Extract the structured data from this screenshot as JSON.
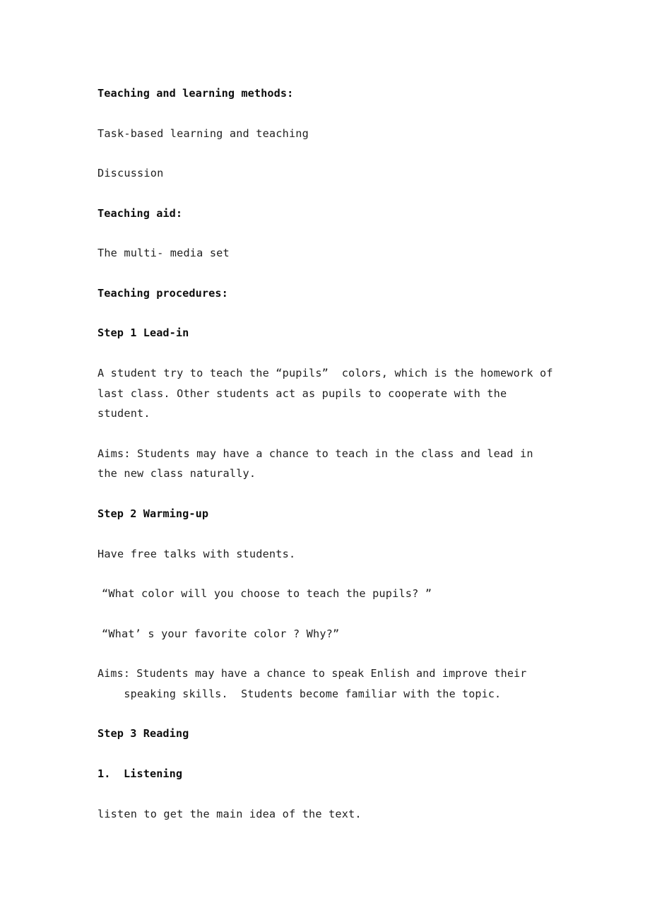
{
  "document": {
    "blocks": [
      {
        "id": "methods-heading",
        "kind": "heading",
        "text": "Teaching and learning methods:"
      },
      {
        "id": "methods-item-1",
        "kind": "body",
        "text": "Task-based learning and teaching"
      },
      {
        "id": "methods-item-2",
        "kind": "body",
        "text": "Discussion"
      },
      {
        "id": "aid-heading",
        "kind": "heading",
        "text": "Teaching aid:"
      },
      {
        "id": "aid-item-1",
        "kind": "body",
        "text": "The multi- media set"
      },
      {
        "id": "procedures-heading",
        "kind": "heading",
        "text": "Teaching procedures:"
      },
      {
        "id": "step1-heading",
        "kind": "heading",
        "text": "Step 1 Lead-in"
      },
      {
        "id": "step1-description",
        "kind": "body",
        "text": "A student try to teach the “pupils”  colors, which is the homework of last class. Other students act as pupils to cooperate with the student."
      },
      {
        "id": "step1-aims",
        "kind": "body",
        "text": "Aims: Students may have a chance to teach in the class and lead in the new class naturally."
      },
      {
        "id": "step2-heading",
        "kind": "heading",
        "text": "Step 2 Warming-up"
      },
      {
        "id": "step2-instruction",
        "kind": "body",
        "text": "Have free talks with students."
      },
      {
        "id": "step2-question-1",
        "kind": "quote",
        "text": "“What color will you choose to teach the pupils? ”"
      },
      {
        "id": "step2-question-2",
        "kind": "quote",
        "text": "“What’ s your favorite color ? Why?”"
      },
      {
        "id": "step2-aims",
        "kind": "body-hang",
        "text": "Aims: Students may have a chance to speak Enlish and improve their speaking skills.  Students become familiar with the topic."
      },
      {
        "id": "step3-heading",
        "kind": "heading",
        "text": "Step 3 Reading"
      },
      {
        "id": "step3-item-1-heading",
        "kind": "numbered",
        "text": "1.  Listening"
      },
      {
        "id": "step3-item-1-body",
        "kind": "body",
        "text": "listen to get the main idea of the text."
      }
    ]
  },
  "style": {
    "page_background": "#ffffff",
    "text_color": "#1f1f1f",
    "heading_color": "#0d0d0d"
  }
}
